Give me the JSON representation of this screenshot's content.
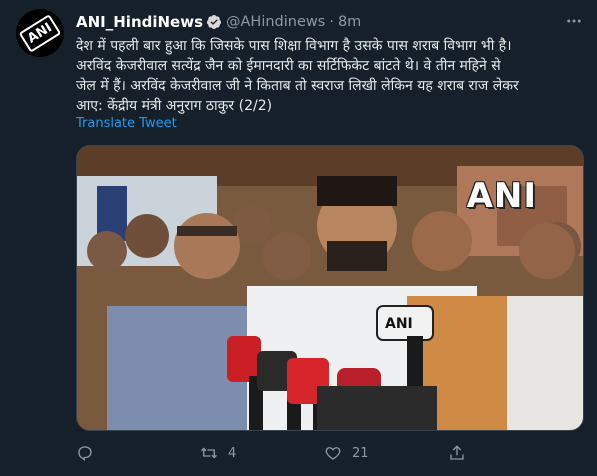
{
  "tweet": {
    "name": "ANI_HindiNews",
    "handle": "@AHindinews",
    "separator": "·",
    "time": "8m",
    "text_line1": "देश में पहली बार हुआ कि जिसके पास शिक्षा विभाग है उसके पास शराब विभाग भी है।",
    "text_line2": "अरविंद केजरीवाल सत्येंद्र जैन को ईमानदारी का सर्टिफिकेट बांटते थे। वे तीन महिने से",
    "text_line3": "जेल में हैं। अरविंद केजरीवाल जी ने किताब तो स्वराज लिखी लेकिन यह शराब राज लेकर",
    "text_line4": "आए: केंद्रीय मंत्री अनुराग ठाकुर (2/2)",
    "translate_label": "Translate Tweet",
    "media_watermark": "ANI",
    "avatar_logo": "ANI"
  },
  "actions": {
    "reply_count": "",
    "retweet_count": "4",
    "like_count": "21"
  },
  "colors": {
    "background": "#15202b",
    "accent": "#1d9bf0",
    "muted": "#8b98a5"
  },
  "icons": [
    "verified-badge-icon",
    "more-icon",
    "reply-icon",
    "retweet-icon",
    "like-icon",
    "share-icon"
  ]
}
